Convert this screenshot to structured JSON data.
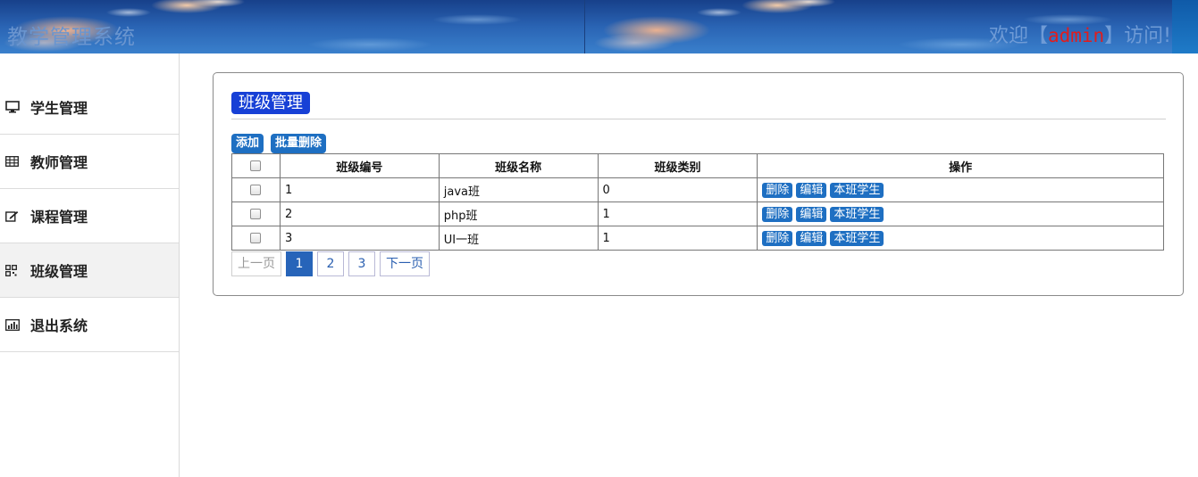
{
  "header": {
    "title": "教学管理系统",
    "welcome_prefix": "欢迎【",
    "user": "admin",
    "welcome_suffix": "】访问!"
  },
  "sidebar": {
    "items": [
      {
        "label": "学生管理",
        "icon": "monitor-icon"
      },
      {
        "label": "教师管理",
        "icon": "table-icon"
      },
      {
        "label": "课程管理",
        "icon": "edit-icon"
      },
      {
        "label": "班级管理",
        "icon": "qrcode-icon",
        "active": true
      },
      {
        "label": "退出系统",
        "icon": "bar-chart-icon"
      }
    ]
  },
  "panel": {
    "title": "班级管理",
    "toolbar": {
      "add_label": "添加",
      "batch_delete_label": "批量删除"
    },
    "table": {
      "columns": [
        "班级编号",
        "班级名称",
        "班级类别",
        "操作"
      ],
      "rows": [
        {
          "id": "1",
          "name": "java班",
          "category": "0"
        },
        {
          "id": "2",
          "name": "php班",
          "category": "1"
        },
        {
          "id": "3",
          "name": "UI一班",
          "category": "1"
        }
      ],
      "row_actions": {
        "delete": "删除",
        "edit": "编辑",
        "students": "本班学生"
      }
    },
    "pager": {
      "prev": "上一页",
      "pages": [
        "1",
        "2",
        "3"
      ],
      "current": "1",
      "next": "下一页"
    }
  },
  "colors": {
    "accent": "#1e6fc2",
    "title_badge": "#1740d6",
    "user_name": "#e21c1c"
  }
}
